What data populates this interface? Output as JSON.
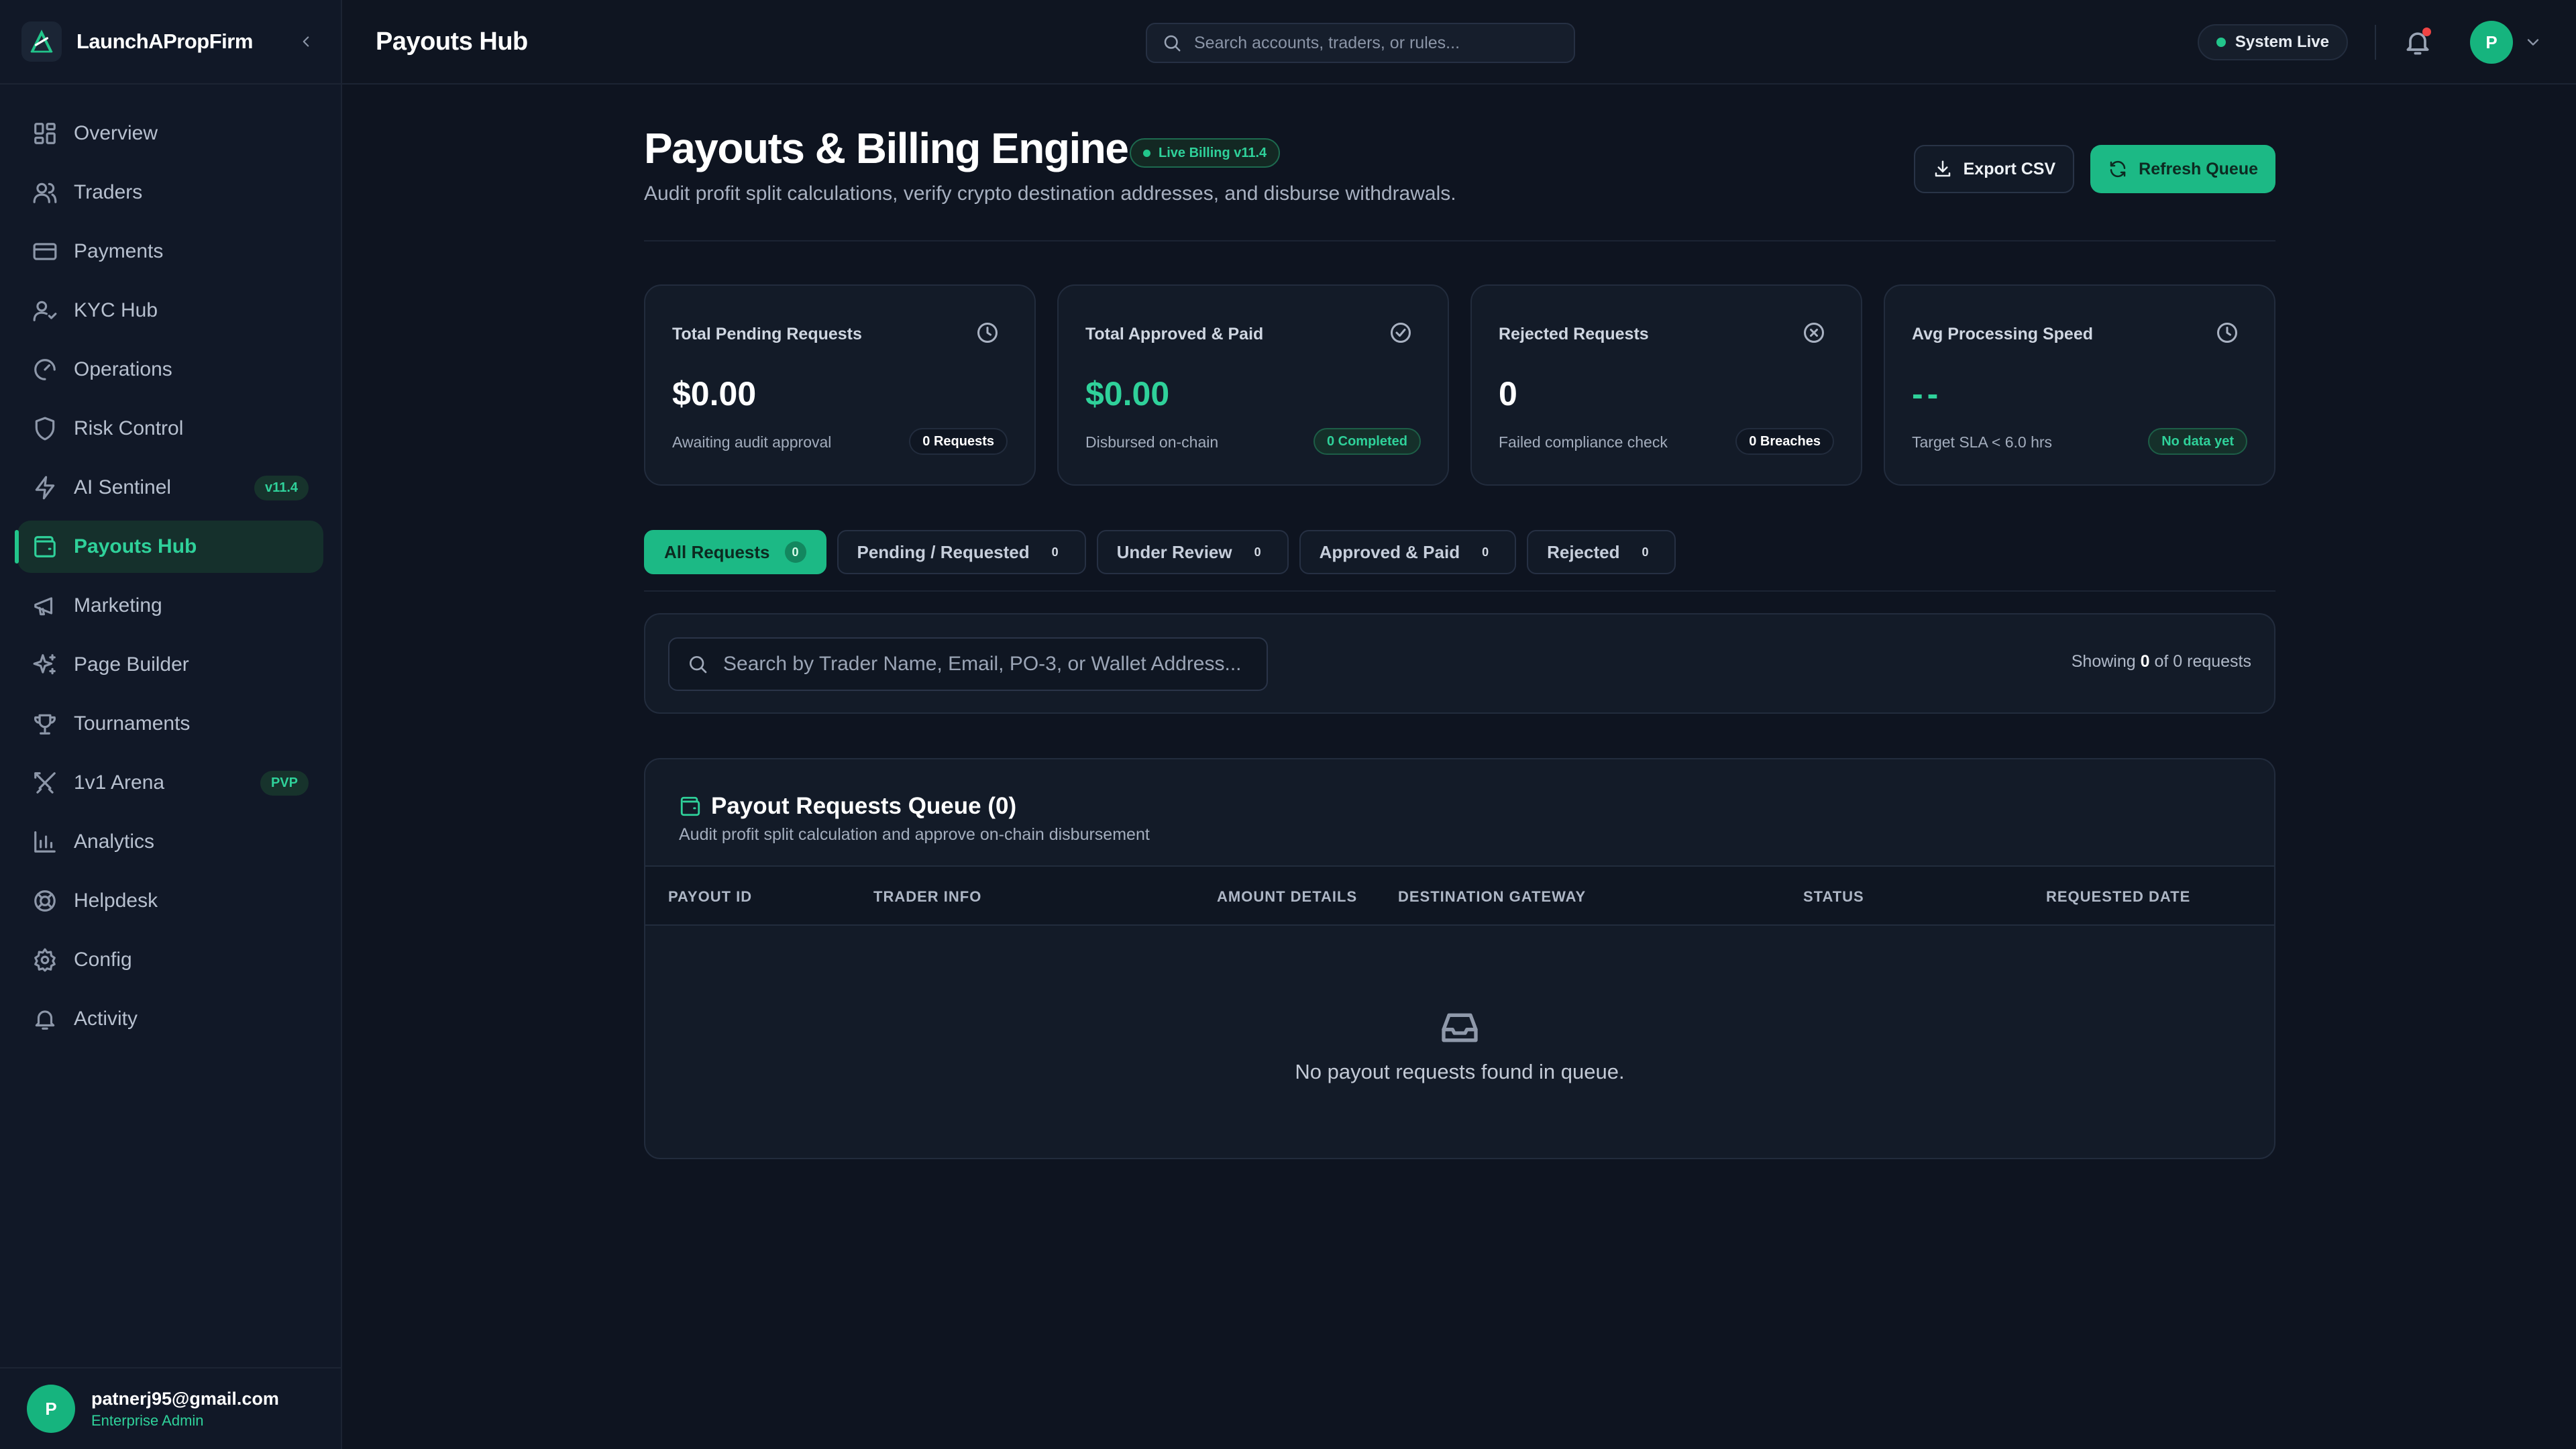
{
  "brand": {
    "name": "LaunchAPropFirm"
  },
  "sidebar": {
    "items": [
      {
        "label": "Overview",
        "icon": "grid-icon"
      },
      {
        "label": "Traders",
        "icon": "users-icon"
      },
      {
        "label": "Payments",
        "icon": "credit-card-icon"
      },
      {
        "label": "KYC Hub",
        "icon": "user-check-icon"
      },
      {
        "label": "Operations",
        "icon": "gauge-icon"
      },
      {
        "label": "Risk Control",
        "icon": "shield-icon"
      },
      {
        "label": "AI Sentinel",
        "icon": "zap-icon",
        "badge": "v11.4"
      },
      {
        "label": "Payouts Hub",
        "icon": "wallet-icon",
        "active": true
      },
      {
        "label": "Marketing",
        "icon": "megaphone-icon"
      },
      {
        "label": "Page Builder",
        "icon": "sparkles-icon"
      },
      {
        "label": "Tournaments",
        "icon": "trophy-icon"
      },
      {
        "label": "1v1 Arena",
        "icon": "swords-icon",
        "badge": "PVP"
      },
      {
        "label": "Analytics",
        "icon": "bar-chart-icon"
      },
      {
        "label": "Helpdesk",
        "icon": "lifebuoy-icon"
      },
      {
        "label": "Config",
        "icon": "settings-icon"
      },
      {
        "label": "Activity",
        "icon": "bell-icon"
      }
    ],
    "user": {
      "initial": "P",
      "email": "patnerj95@gmail.com",
      "role": "Enterprise Admin"
    }
  },
  "topbar": {
    "title": "Payouts Hub",
    "search_placeholder": "Search accounts, traders, or rules...",
    "status": "System Live",
    "avatar_initial": "P"
  },
  "page": {
    "title": "Payouts & Billing Engine",
    "badge": "Live Billing v11.4",
    "subtitle": "Audit profit split calculations, verify crypto destination addresses, and disburse withdrawals.",
    "export_label": "Export CSV",
    "refresh_label": "Refresh Queue"
  },
  "stats": [
    {
      "label": "Total Pending Requests",
      "value": "$0.00",
      "caption": "Awaiting audit approval",
      "chip": "0 Requests",
      "icon": "clock-icon"
    },
    {
      "label": "Total Approved & Paid",
      "value": "$0.00",
      "caption": "Disbursed on-chain",
      "chip": "0 Completed",
      "icon": "check-circle-icon"
    },
    {
      "label": "Rejected Requests",
      "value": "0",
      "caption": "Failed compliance check",
      "chip": "0 Breaches",
      "icon": "x-circle-icon"
    },
    {
      "label": "Avg Processing Speed",
      "value": "--",
      "caption": "Target SLA < 6.0 hrs",
      "chip": "No data yet",
      "icon": "clock-icon"
    }
  ],
  "tabs": [
    {
      "label": "All Requests",
      "count": "0",
      "active": true
    },
    {
      "label": "Pending / Requested",
      "count": "0"
    },
    {
      "label": "Under Review",
      "count": "0"
    },
    {
      "label": "Approved & Paid",
      "count": "0"
    },
    {
      "label": "Rejected",
      "count": "0"
    }
  ],
  "filter": {
    "placeholder": "Search by Trader Name, Email, PO-3, or Wallet Address...",
    "showing_prefix": "Showing",
    "showing_count": "0",
    "showing_suffix": "of 0 requests"
  },
  "queue": {
    "title": "Payout Requests Queue (0)",
    "subtitle": "Audit profit split calculation and approve on-chain disbursement",
    "columns": [
      "PAYOUT ID",
      "TRADER INFO",
      "AMOUNT DETAILS",
      "DESTINATION GATEWAY",
      "STATUS",
      "REQUESTED DATE"
    ],
    "empty_text": "No payout requests found in queue.",
    "empty_icon": "inbox-icon"
  },
  "colors": {
    "accent": "#1cb985",
    "accent_text": "#2fd19a",
    "background": "#0e1420",
    "card": "#131b28",
    "alert": "#ef4444"
  }
}
